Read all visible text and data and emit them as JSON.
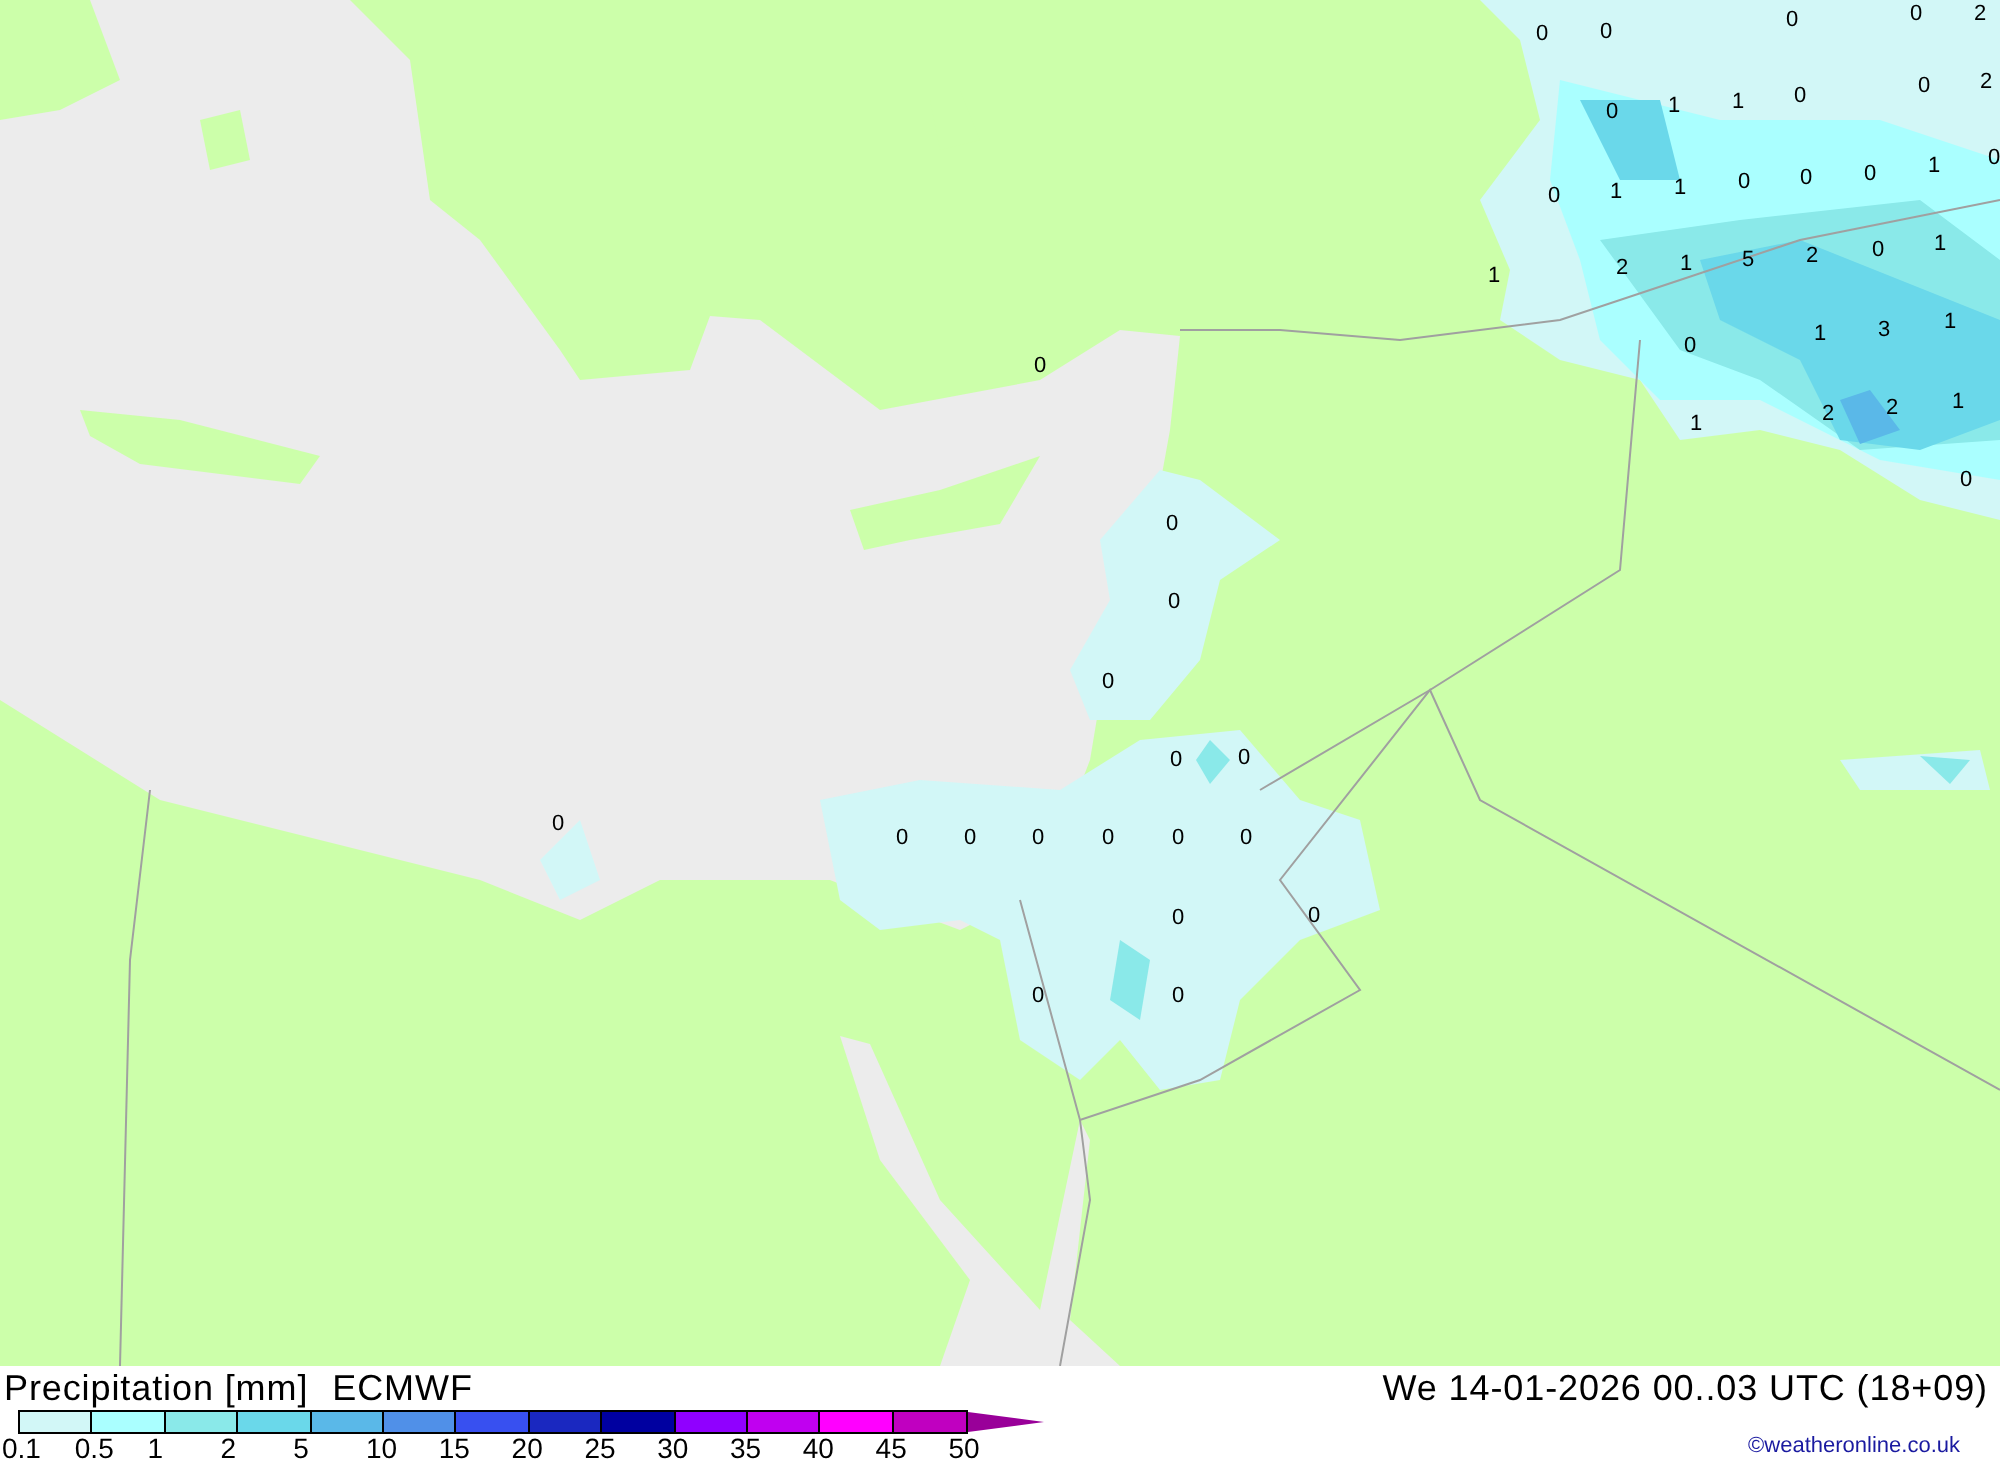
{
  "title": "Precipitation [mm]",
  "model": "ECMWF",
  "datetime": "We 14-01-2026 00..03 UTC (18+09)",
  "credit": "©weatheronline.co.uk",
  "legend": {
    "swatches": [
      {
        "color": "#d2f7f7"
      },
      {
        "color": "#aaffff"
      },
      {
        "color": "#8ae9e9"
      },
      {
        "color": "#6ad8ea"
      },
      {
        "color": "#5ab8e8"
      },
      {
        "color": "#5090e8"
      },
      {
        "color": "#3850f0"
      },
      {
        "color": "#1a28c0"
      },
      {
        "color": "#0000a0"
      },
      {
        "color": "#9000ff"
      },
      {
        "color": "#c000f0"
      },
      {
        "color": "#ff00ff"
      },
      {
        "color": "#c000c0"
      }
    ],
    "ticks": [
      "0.1",
      "0.5",
      "1",
      "2",
      "5",
      "10",
      "15",
      "20",
      "25",
      "30",
      "35",
      "40",
      "45",
      "50"
    ]
  },
  "map_labels": [
    "0",
    "0",
    "0",
    "0",
    "2",
    "0",
    "2",
    "0",
    "1",
    "1",
    "0",
    "1",
    "0",
    "0",
    "1",
    "1",
    "0",
    "0",
    "0",
    "1",
    "2",
    "1",
    "5",
    "2",
    "0",
    "1",
    "0",
    "1",
    "3",
    "1",
    "1",
    "2",
    "2",
    "1",
    "0",
    "0",
    "0",
    "0",
    "0",
    "0",
    "0",
    "0",
    "0",
    "0",
    "0",
    "0",
    "0",
    "0",
    "0",
    "0",
    "0",
    "0"
  ]
}
